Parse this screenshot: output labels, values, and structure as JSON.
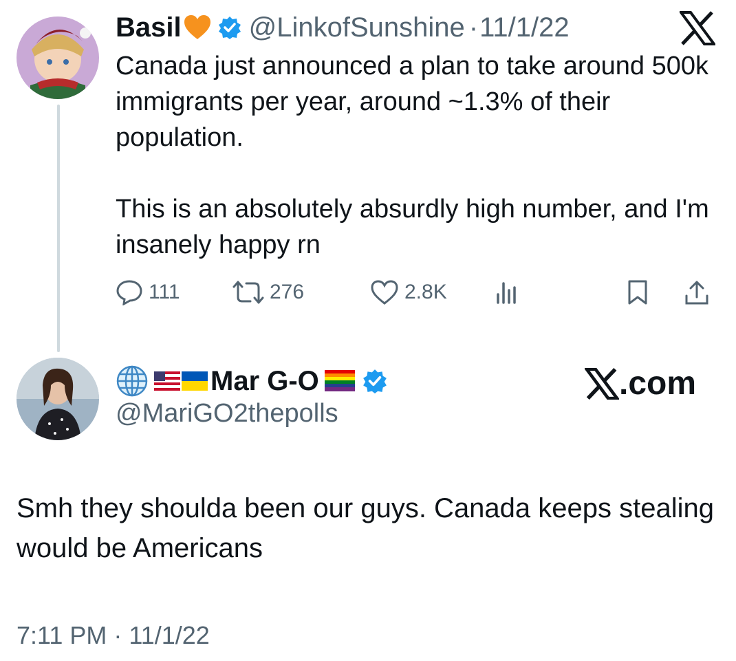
{
  "quoted_tweet": {
    "display_name": "Basil",
    "name_emoji": "🧡",
    "handle": "@LinkofSunshine",
    "separator": "·",
    "date": "11/1/22",
    "paragraphs": [
      "Canada just announced a plan to take around 500k immigrants per year, around ~1.3% of their population.",
      "This is an absolutely absurdly high number, and I'm insanely happy rn"
    ],
    "actions": {
      "replies": "111",
      "retweets": "276",
      "likes": "2.8K"
    },
    "icons": [
      "reply-icon",
      "retweet-icon",
      "like-icon",
      "views-icon",
      "bookmark-icon",
      "share-icon"
    ]
  },
  "main_tweet": {
    "display_name": "Mar G-O",
    "handle": "@MariGO2thepolls",
    "text": "Smh they shoulda been our guys. Canada keeps stealing would be Americans",
    "timestamp": "7:11 PM · 11/1/22",
    "icons": [
      "globe-icon",
      "us-flag-icon",
      "ukraine-flag-icon",
      "rainbow-flag-icon",
      "verified-badge-icon"
    ]
  },
  "brand": {
    "xcom_suffix": ".com"
  },
  "colors": {
    "text": "#0f1419",
    "secondary": "#536471",
    "verified": "#1d9bf0",
    "thread_line": "#cfd9de"
  }
}
